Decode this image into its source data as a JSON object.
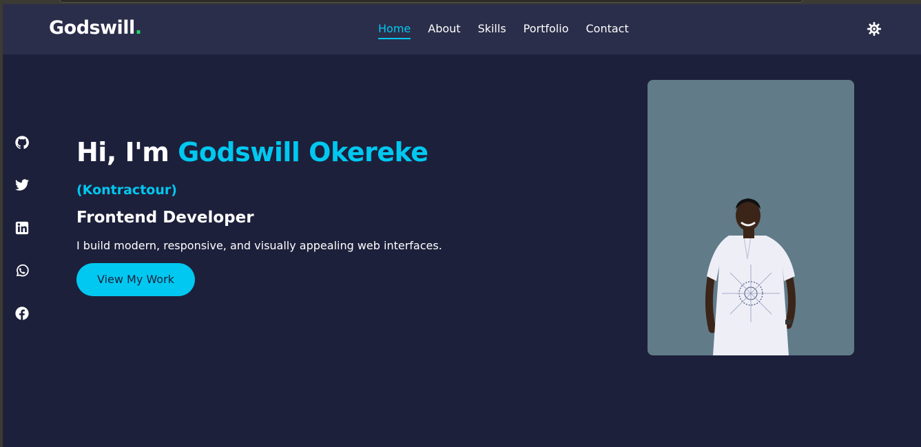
{
  "nav": {
    "logo": "Godswill",
    "logo_dot": ".",
    "links": [
      "Home",
      "About",
      "Skills",
      "Portfolio",
      "Contact"
    ],
    "active": "Home",
    "theme_icon": "gear-icon"
  },
  "socials": [
    "github-icon",
    "twitter-icon",
    "linkedin-icon",
    "whatsapp-icon",
    "facebook-icon"
  ],
  "hero": {
    "greeting": "Hi, I'm",
    "name": "Godswill Okereke",
    "nickname": "(Kontractour)",
    "role": "Frontend Developer",
    "tagline": "I build modern, responsive, and visually appealing web interfaces.",
    "cta": "View My Work"
  },
  "colors": {
    "accent": "#00c8f0",
    "background": "#1d203b",
    "navbar": "#2b2e4a",
    "logo_dot": "#22d66b",
    "photo_bg": "#617b89"
  }
}
